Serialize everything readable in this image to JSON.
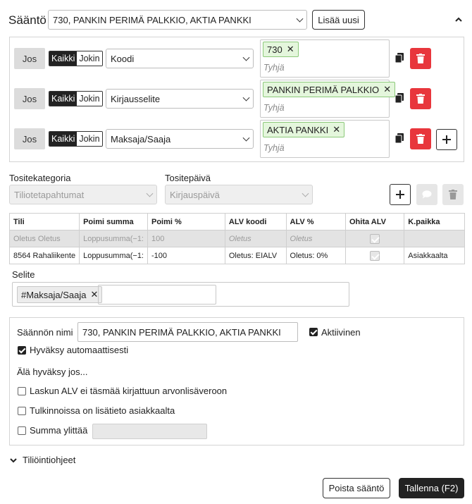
{
  "header": {
    "rule_label": "Sääntö",
    "rule_selected": "730, PANKIN PERIMÄ PALKKIO, AKTIA PANKKI",
    "add_new_label": "Lisää uusi",
    "collapse_icon": "chevron-up-icon"
  },
  "conditions": [
    {
      "jos": "Jos",
      "all": "Kaikki",
      "any": "Jokin",
      "field": "Koodi",
      "tag": "730",
      "placeholder": "Tyhjä"
    },
    {
      "jos": "Jos",
      "all": "Kaikki",
      "any": "Jokin",
      "field": "Kirjausselite",
      "tag": "PANKIN PERIMÄ PALKKIO",
      "placeholder": "Tyhjä"
    },
    {
      "jos": "Jos",
      "all": "Kaikki",
      "any": "Jokin",
      "field": "Maksaja/Saaja",
      "tag": "AKTIA PANKKI",
      "placeholder": "Tyhjä"
    }
  ],
  "voucher": {
    "category_label": "Tositekategoria",
    "category_value": "Tiliotetapahtumat",
    "date_label": "Tositepäivä",
    "date_value": "Kirjauspäivä"
  },
  "table": {
    "headers": [
      "Tili",
      "Poimi summa",
      "Poimi %",
      "ALV koodi",
      "ALV %",
      "Ohita ALV",
      "K.paikka"
    ],
    "rows": [
      [
        "Oletus Oletus",
        "Loppusumma(−1:",
        "100",
        "Oletus",
        "Oletus",
        "",
        ""
      ],
      [
        "8564 Rahaliikente",
        "Loppusumma(−1:",
        "-100",
        "Oletus:  EIALV",
        "Oletus:  0%",
        "",
        "Asiakkaalta"
      ]
    ]
  },
  "selite": {
    "label": "Selite",
    "tag": "#Maksaja/Saaja"
  },
  "settings": {
    "name_label": "Säännön nimi",
    "name_value": "730, PANKIN PERIMÄ PALKKIO, AKTIA PANKKI",
    "active_label": "Aktiivinen",
    "auto_approve_label": "Hyväksy automaattisesti",
    "dont_approve_label": "Älä hyväksy jos...",
    "opt_vat_label": "Laskun ALV ei täsmää kirjattuun arvonlisäveroon",
    "opt_info_label": "Tulkinnoissa on lisätieto asiakkaalta",
    "opt_sum_label": "Summa ylittää"
  },
  "footer": {
    "instructions_label": "Tiliöintiohjeet",
    "delete_label": "Poista sääntö",
    "save_label": "Tallenna (F2)"
  },
  "colors": {
    "danger": "#e8363c",
    "tag_bg": "#e4f6dc",
    "tag_border": "#8cc97a",
    "dark": "#222222"
  }
}
